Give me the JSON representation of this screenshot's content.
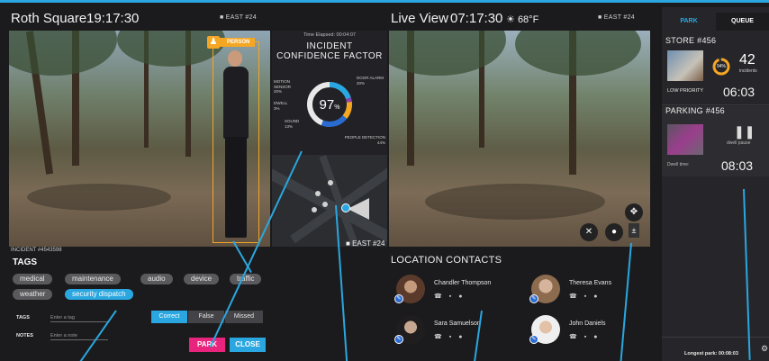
{
  "left_header": {
    "location": "Roth Square",
    "time": "19:17:30",
    "camera": "EAST #24"
  },
  "right_header": {
    "title": "Live View",
    "time": "07:17:30",
    "weather": "68°F",
    "camera": "EAST #24"
  },
  "detection": {
    "label": "PERSON"
  },
  "incident": {
    "id": "INCIDENT #4543598"
  },
  "analytics": {
    "elapsed": "Time Elapsed: 00:04:07",
    "title_line1": "INCIDENT",
    "title_line2": "CONFIDENCE FACTOR",
    "confidence": "97",
    "confidence_unit": "%",
    "factors": [
      {
        "name": "MOTION SENSOR",
        "value": "20%"
      },
      {
        "name": "DWELL",
        "value": "3%"
      },
      {
        "name": "SOUND",
        "value": "13%"
      },
      {
        "name": "DOOR ALARM",
        "value": "20%"
      },
      {
        "name": "PEOPLE DETECTION",
        "value": "44%"
      }
    ],
    "factor_shares": [
      20,
      3,
      13,
      20,
      44
    ],
    "colors": [
      "#2aa7e0",
      "#8e44ad",
      "#f5a623",
      "#2a6bd1",
      "#e8e8e8"
    ]
  },
  "map": {
    "camera": "EAST #24"
  },
  "tags": {
    "title": "TAGS",
    "chips": [
      "medical",
      "maintenance",
      "audio",
      "device",
      "traffic",
      "weather",
      "security dispatch"
    ],
    "active": "security dispatch"
  },
  "form": {
    "tags_label": "TAGS",
    "tags_placeholder": "Enter a tag",
    "notes_label": "NOTES",
    "notes_placeholder": "Enter a note"
  },
  "verdict": {
    "correct": "Correct",
    "false": "False",
    "missed": "Missed",
    "selected": "Correct"
  },
  "actions": {
    "park": "PARK",
    "close": "CLOSE"
  },
  "contacts": {
    "title": "LOCATION CONTACTS",
    "people": [
      {
        "name": "Chandler Thompson"
      },
      {
        "name": "Theresa Evans"
      },
      {
        "name": "Sara Samuelson"
      },
      {
        "name": "John Daniels"
      }
    ]
  },
  "sidebar": {
    "tabs": {
      "park": "PARK",
      "queue": "QUEUE"
    },
    "store": {
      "title": "STORE #456",
      "percent": "94%",
      "count": "42",
      "count_label": "incidents",
      "priority": "LOW PRIORITY",
      "timer": "06:03"
    },
    "parking": {
      "title": "PARKING #456",
      "pause_label": "dwell pause",
      "dwell_label": "Dwell time:",
      "timer": "08:03"
    },
    "longest": "Longest park: 00:08:03"
  }
}
